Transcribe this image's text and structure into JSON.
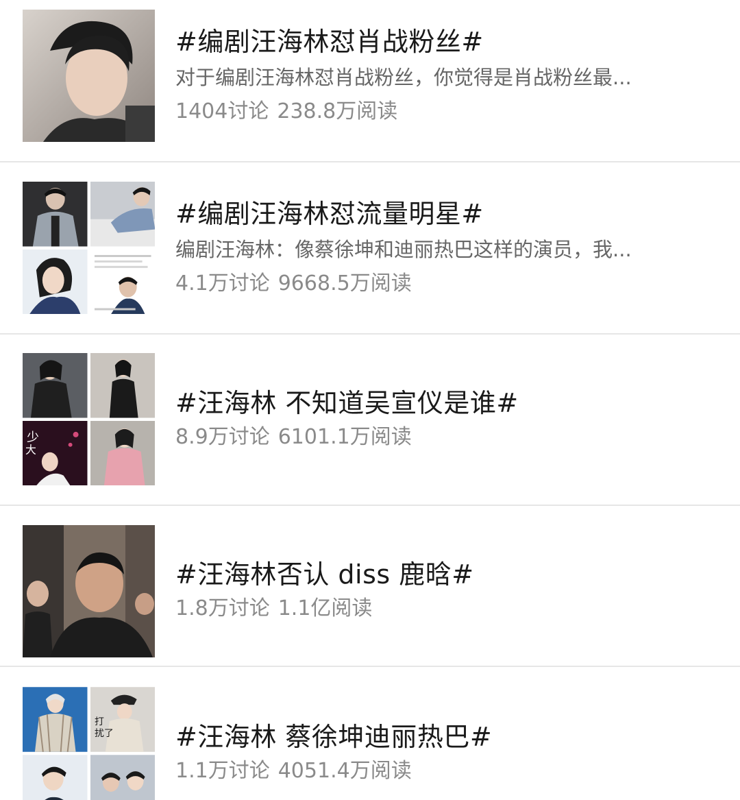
{
  "topics": [
    {
      "title": "#编剧汪海林怼肖战粉丝#",
      "summary": "对于编剧汪海林怼肖战粉丝，你觉得是肖战粉丝最...",
      "discussions": "1404讨论",
      "reads": "238.8万阅读",
      "thumbnail": "portrait-photo"
    },
    {
      "title": "#编剧汪海林怼流量明星#",
      "summary": "编剧汪海林：像蔡徐坤和迪丽热巴这样的演员，我...",
      "discussions": "4.1万讨论",
      "reads": "9668.5万阅读",
      "thumbnail": "photo-collage"
    },
    {
      "title": "#汪海林 不知道吴宣仪是谁#",
      "summary": "",
      "discussions": "8.9万讨论",
      "reads": "6101.1万阅读",
      "thumbnail": "photo-collage"
    },
    {
      "title": "#汪海林否认 diss 鹿晗#",
      "summary": "",
      "discussions": "1.8万讨论",
      "reads": "1.1亿阅读",
      "thumbnail": "portrait-photo"
    },
    {
      "title": "#汪海林 蔡徐坤迪丽热巴#",
      "summary": "",
      "discussions": "1.1万讨论",
      "reads": "4051.4万阅读",
      "thumbnail": "photo-collage"
    }
  ],
  "colors": {
    "title_text": "#1a1a1a",
    "summary_text": "#666666",
    "stats_text": "#8a8a8a",
    "divider": "#e6e6e6",
    "background": "#ffffff"
  }
}
